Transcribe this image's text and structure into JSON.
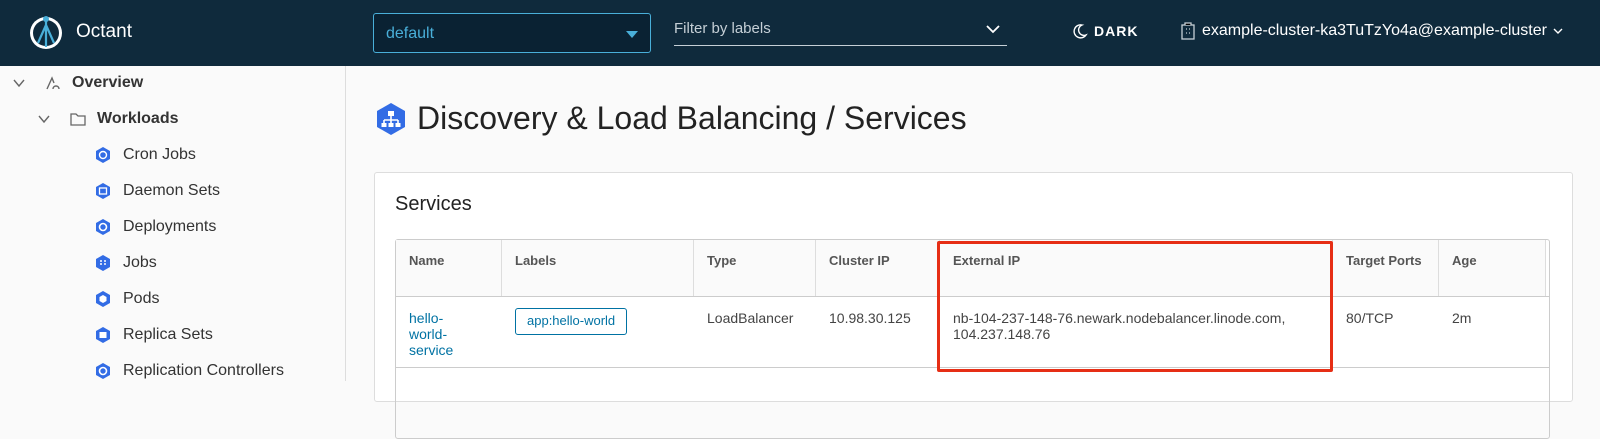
{
  "header": {
    "app_title": "Octant",
    "namespace": "default",
    "filter_placeholder": "Filter by labels",
    "theme_label": "DARK",
    "cluster": "example-cluster-ka3TuTzYo4a@example-cluster"
  },
  "sidebar": {
    "overview": "Overview",
    "workloads": "Workloads",
    "items": [
      {
        "label": "Cron Jobs",
        "icon": "cronjob-icon"
      },
      {
        "label": "Daemon Sets",
        "icon": "daemonset-icon"
      },
      {
        "label": "Deployments",
        "icon": "deployment-icon"
      },
      {
        "label": "Jobs",
        "icon": "job-icon"
      },
      {
        "label": "Pods",
        "icon": "pod-icon"
      },
      {
        "label": "Replica Sets",
        "icon": "replicaset-icon"
      },
      {
        "label": "Replication Controllers",
        "icon": "replication-controller-icon"
      }
    ]
  },
  "page": {
    "title": "Discovery & Load Balancing / Services"
  },
  "card": {
    "title": "Services",
    "columns": [
      "Name",
      "Labels",
      "Type",
      "Cluster IP",
      "External IP",
      "Target Ports",
      "Age"
    ],
    "rows": [
      {
        "name": "hello-world-service",
        "labels": "app:hello-world",
        "type": "LoadBalancer",
        "cluster_ip": "10.98.30.125",
        "external_ip": "nb-104-237-148-76.newark.nodebalancer.linode.com, 104.237.148.76",
        "target_ports": "80/TCP",
        "age": "2m"
      }
    ]
  },
  "colors": {
    "header_bg": "#0f2a3c",
    "accent": "#49afd9",
    "link": "#0072a3",
    "highlight": "#e62e15",
    "resource_icon": "#326ce5"
  }
}
